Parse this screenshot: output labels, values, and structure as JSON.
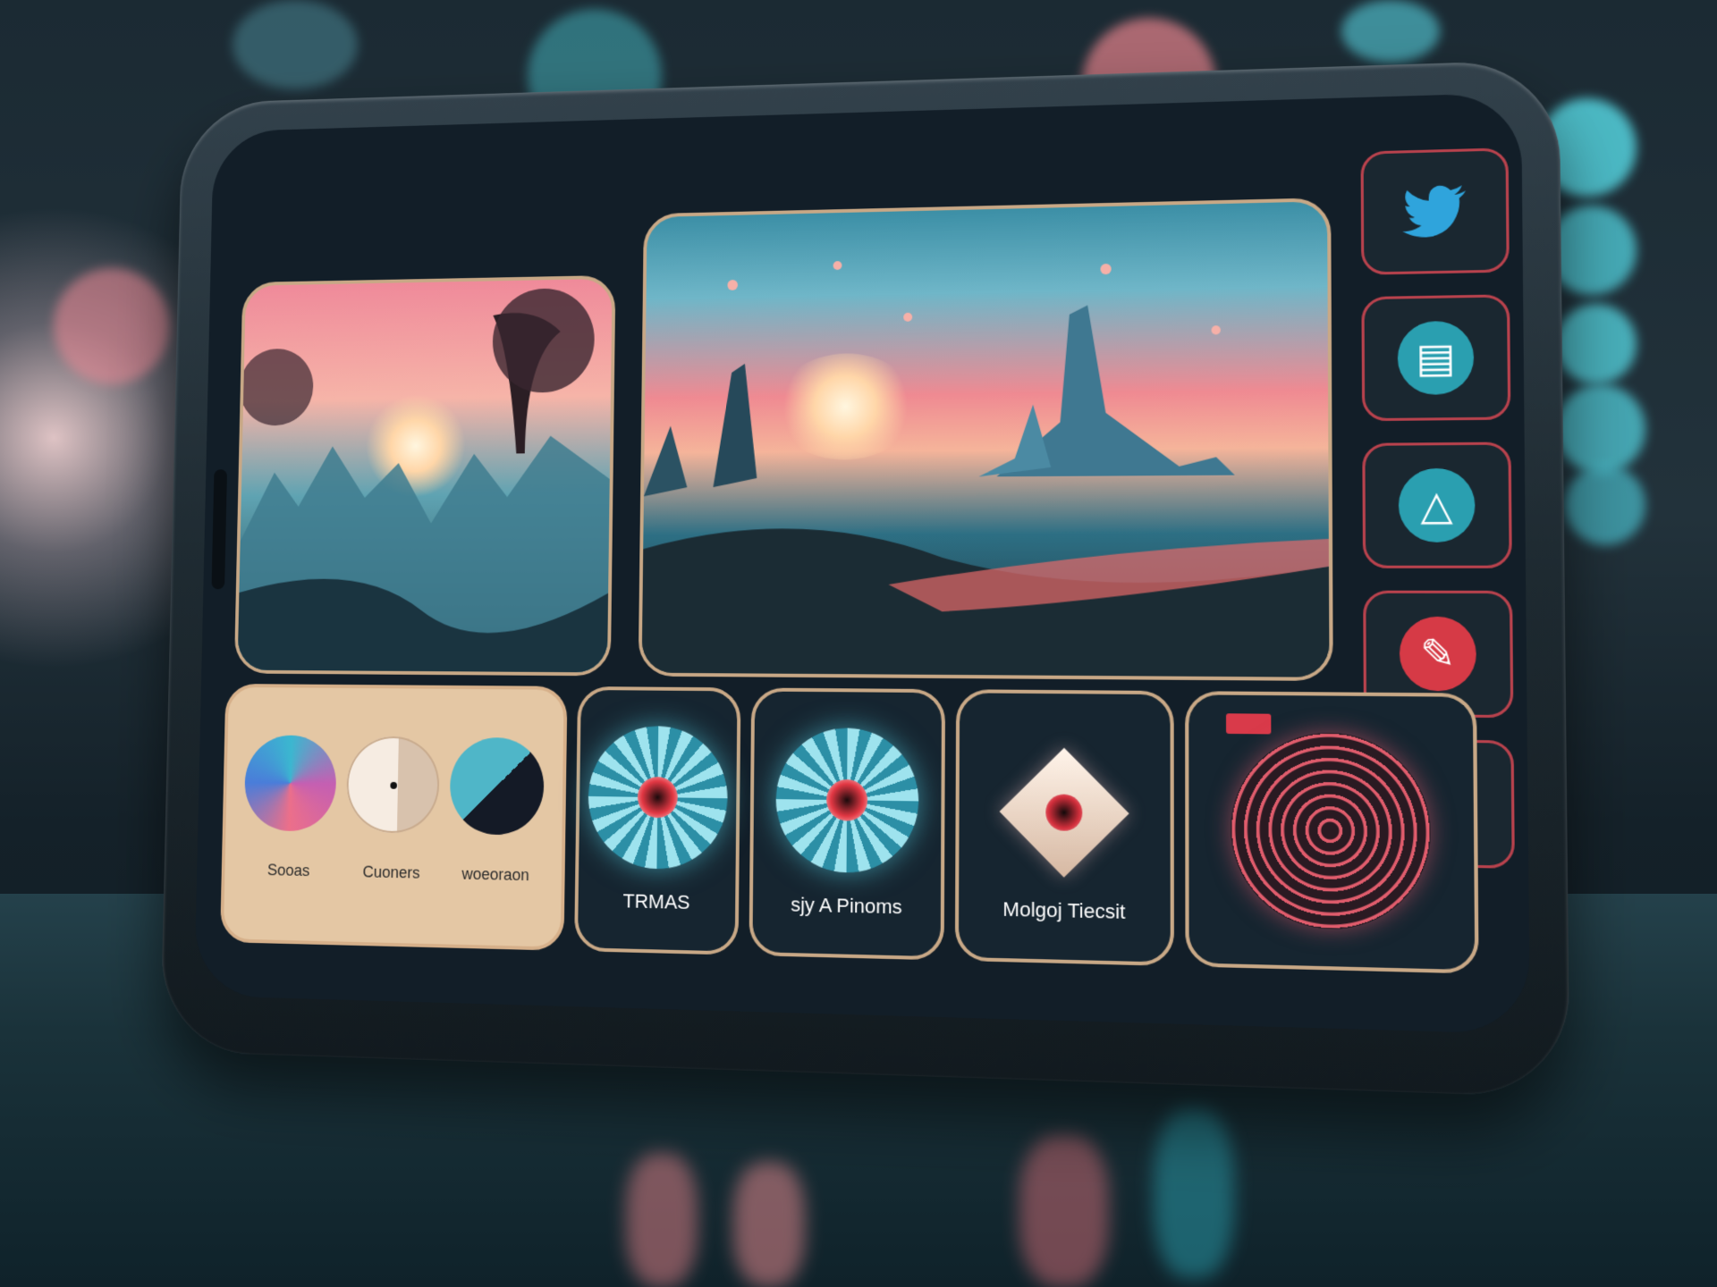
{
  "side_rail": {
    "items": [
      {
        "icon": "bird-icon",
        "color": "#2a9fd8"
      },
      {
        "icon": "gallery-icon",
        "color": "#2a9fb0"
      },
      {
        "icon": "shape-icon",
        "color": "#2a9fb0"
      },
      {
        "icon": "pen-icon",
        "color": "#d63a46"
      },
      {
        "icon": "grid-dots-icon",
        "color": "#d63a46"
      }
    ]
  },
  "filters": {
    "items": [
      {
        "label": "Sooas"
      },
      {
        "label": "Cuoners"
      },
      {
        "label": "woeoraon"
      }
    ]
  },
  "tiles": {
    "items": [
      {
        "label": "TRMAS"
      },
      {
        "label": "sjy A Pinoms"
      },
      {
        "label": "Molgoj Tiecsit"
      }
    ]
  },
  "colors": {
    "accent": "#d93a4a",
    "cyan": "#4fc9d6",
    "panel_border": "#c8a886"
  }
}
